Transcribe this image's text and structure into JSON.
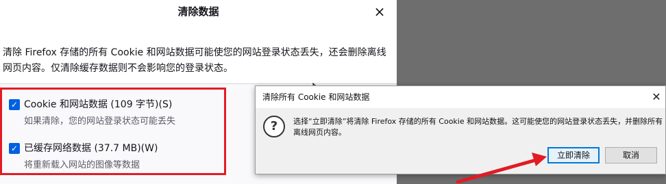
{
  "dialog": {
    "title": "清除数据",
    "close_glyph": "×",
    "description": "清除 Firefox 存储的所有 Cookie 和网站数据可能使您的网站登录状态丢失，还会删除离线网页内容。仅清除缓存数据则不会影响您的登录状态。",
    "options": [
      {
        "label": "Cookie 和网站数据 (109 字节)(S)",
        "sub": "如果清除，您的网站登录状态可能丢失",
        "checked": true
      },
      {
        "label": "已缓存网络数据 (37.7 MB)(W)",
        "sub": "将重新载入网站的图像等数据",
        "checked": true
      }
    ]
  },
  "confirm": {
    "title": "清除所有 Cookie 和网站数据",
    "close_glyph": "✕",
    "icon": "question-icon",
    "message": "选择“立即清除”将清除 Firefox 存储的所有 Cookie 和网站数据。这可能使您的网站登录状态丢失，并删除所有离线网页内容。",
    "primary_label": "立即清除",
    "cancel_label": "取消"
  },
  "colors": {
    "highlight_box": "#e21b24",
    "annotation_arrow": "#e21b24",
    "checkbox": "#0061e0",
    "primary_button_border": "#0078d7"
  }
}
